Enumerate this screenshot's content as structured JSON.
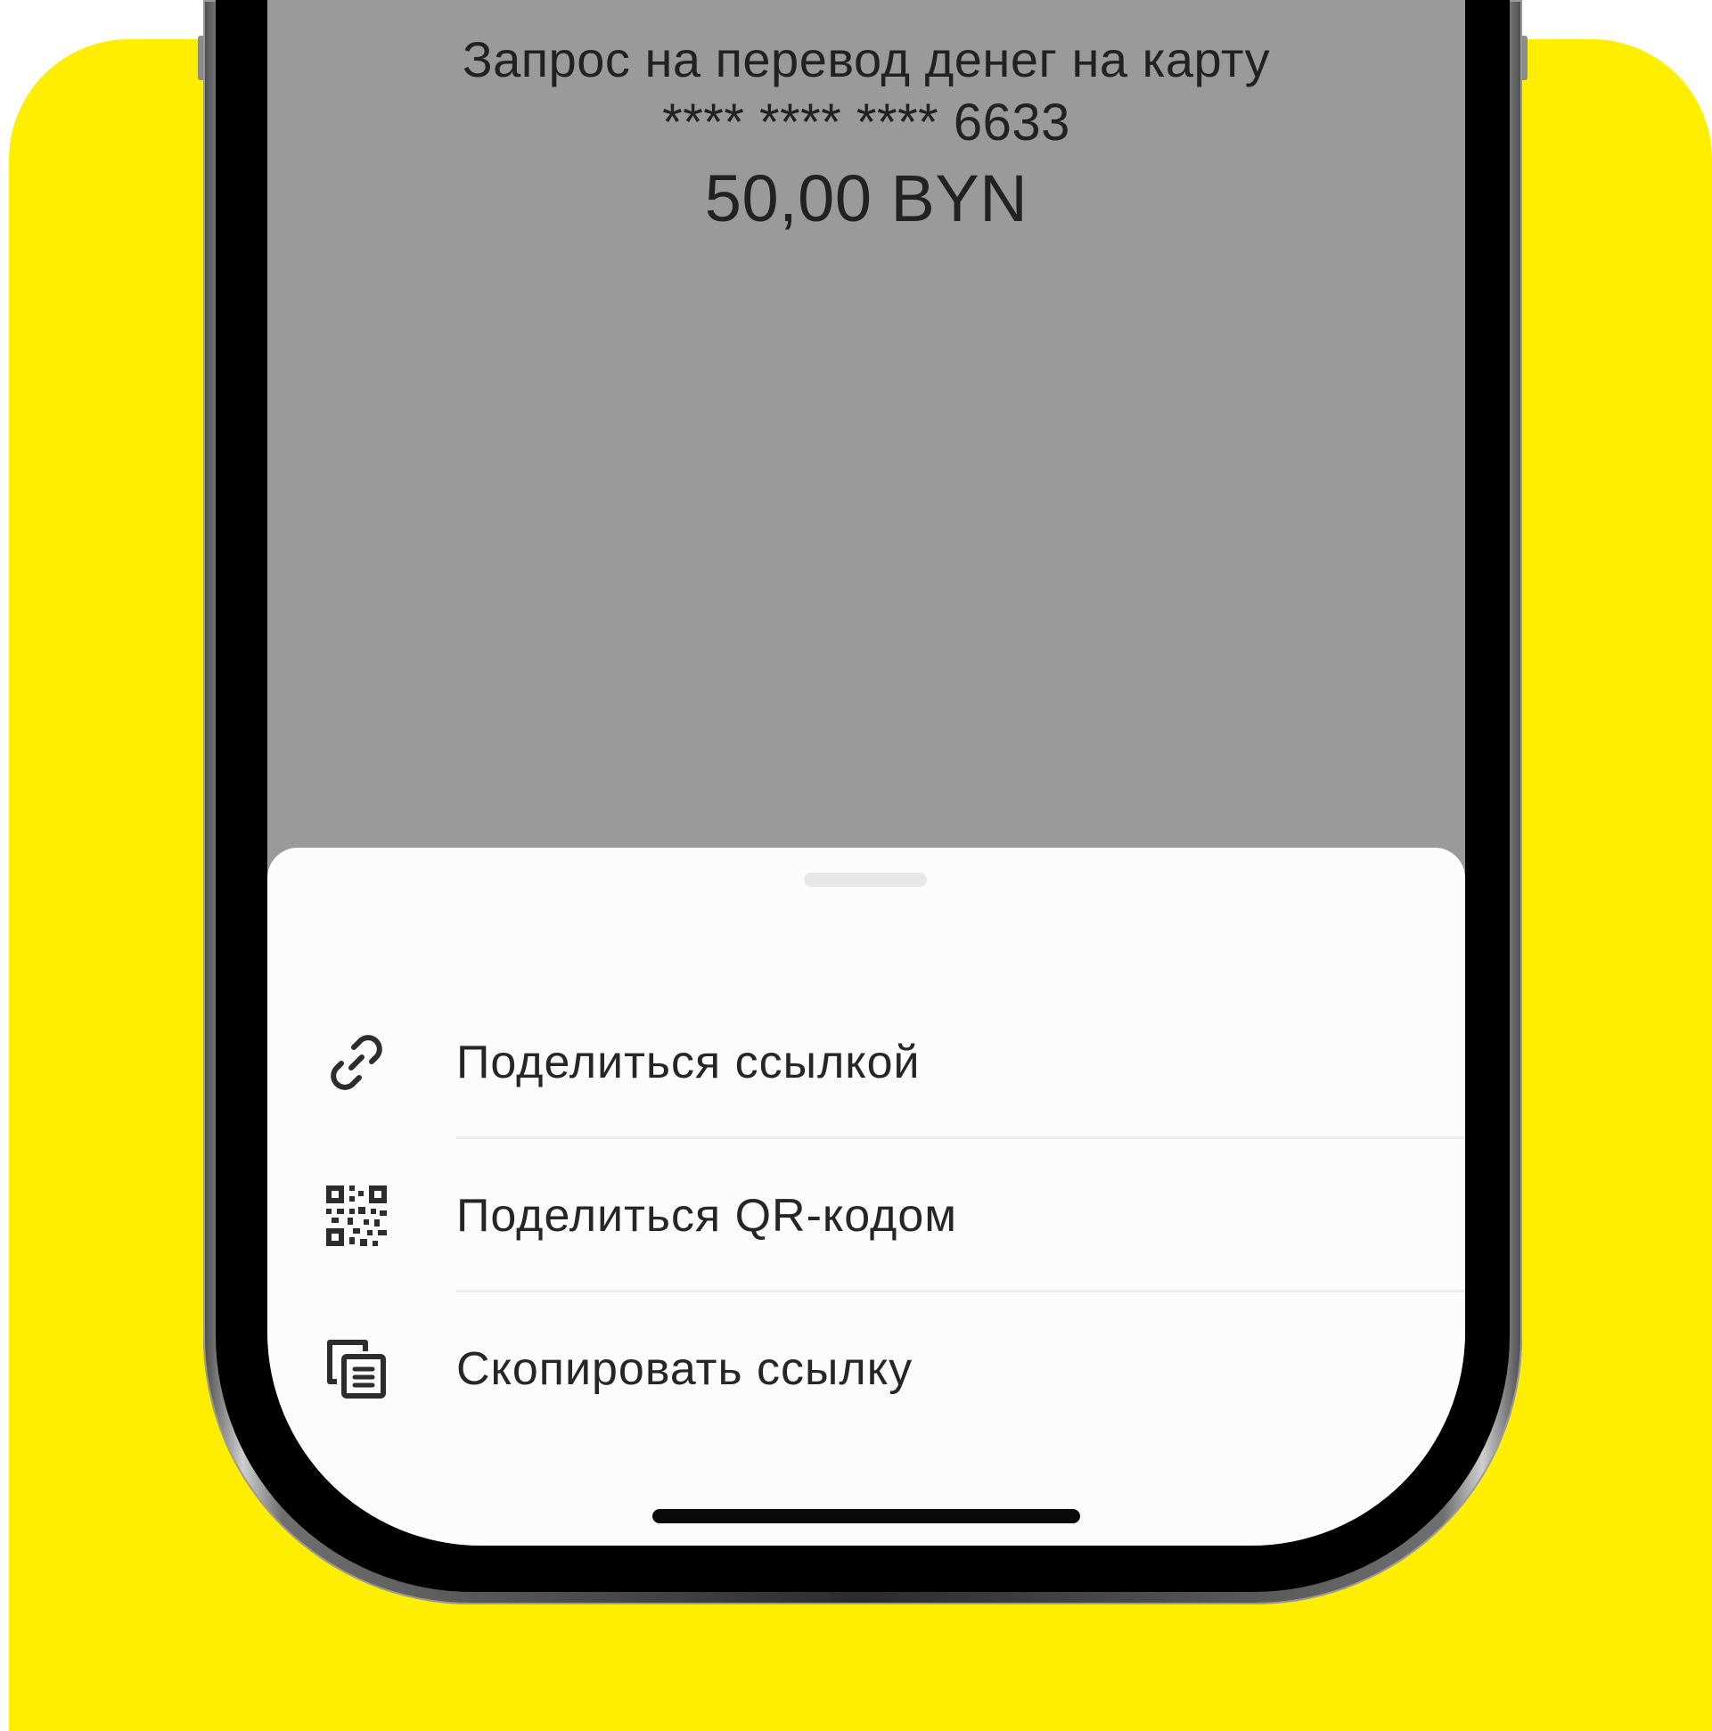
{
  "request": {
    "title": "Запрос на перевод денег на карту",
    "card_number": "**** **** **** 6633",
    "amount": "50,00 BYN"
  },
  "share_sheet": {
    "items": [
      {
        "label": "Поделиться ссылкой",
        "icon": "link-icon"
      },
      {
        "label": "Поделиться QR-кодом",
        "icon": "qr-code-icon"
      },
      {
        "label": "Скопировать ссылку",
        "icon": "copy-icon"
      }
    ]
  },
  "colors": {
    "background_accent": "#ffee00",
    "dimmed_screen": "#9a9a9a",
    "sheet_background": "#fcfcfc",
    "text": "#262626"
  }
}
